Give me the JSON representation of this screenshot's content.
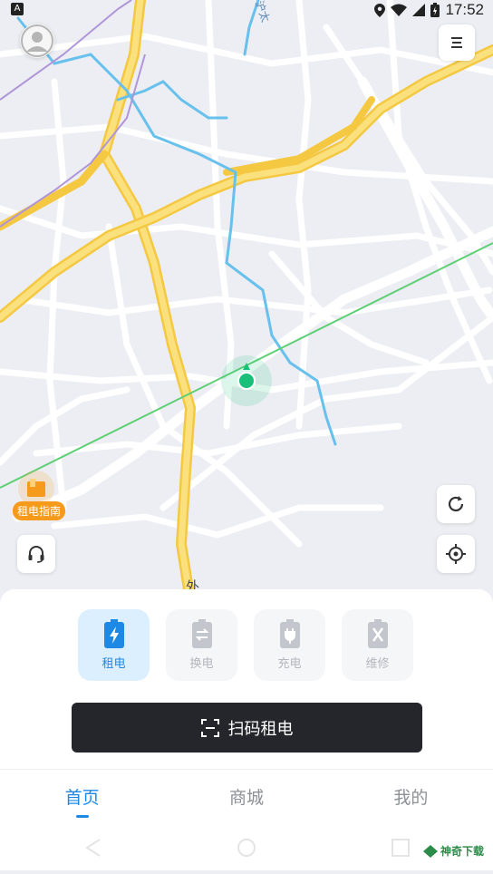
{
  "status_bar": {
    "time": "17:52"
  },
  "map": {
    "road_label_top": "沪太",
    "road_label_bottom": "外"
  },
  "guide": {
    "label": "租电指南"
  },
  "services": [
    {
      "label": "租电",
      "icon": "battery-bolt-icon",
      "active": true
    },
    {
      "label": "换电",
      "icon": "battery-swap-icon",
      "active": false
    },
    {
      "label": "充电",
      "icon": "battery-plug-icon",
      "active": false
    },
    {
      "label": "维修",
      "icon": "battery-repair-icon",
      "active": false
    }
  ],
  "scan_button": {
    "label": "扫码租电",
    "icon": "scan-icon"
  },
  "tabs": [
    {
      "label": "首页",
      "active": true
    },
    {
      "label": "商城",
      "active": false
    },
    {
      "label": "我的",
      "active": false
    }
  ],
  "watermark": {
    "text": "神奇下载"
  },
  "colors": {
    "accent": "#1e88e5",
    "location": "#19c07a",
    "guide": "#f59a1a"
  }
}
